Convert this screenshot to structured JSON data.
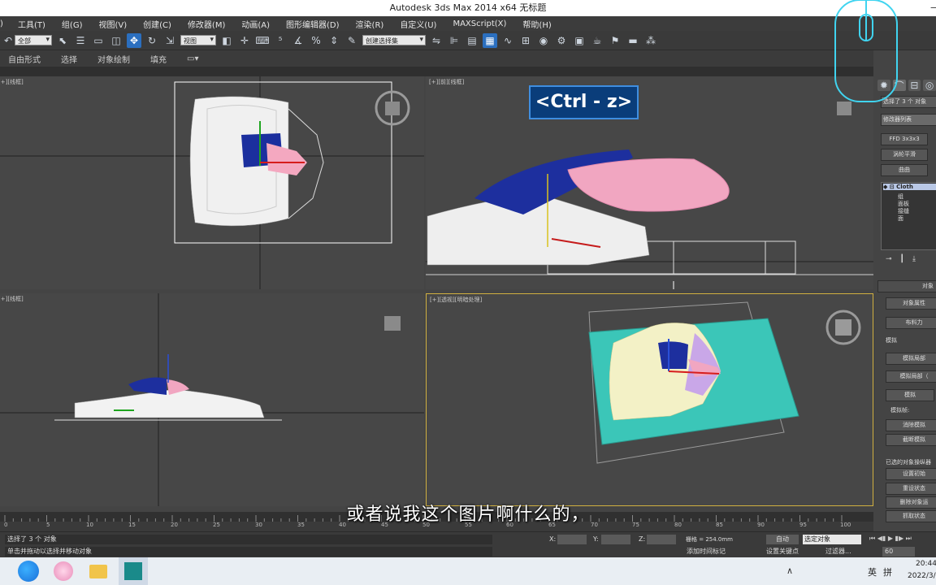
{
  "window": {
    "title": "Autodesk 3ds Max  2014 x64     无标题",
    "minimize": "—"
  },
  "menu": [
    "工具(T)",
    "组(G)",
    "视图(V)",
    "创建(C)",
    "修改器(M)",
    "动画(A)",
    "图形编辑器(D)",
    "渲染(R)",
    "自定义(U)",
    "MAXScript(X)",
    "帮助(H)"
  ],
  "toolbar": {
    "selection_filter": "全部",
    "ref_coord": "视图",
    "named_selection": "创建选择集"
  },
  "ribbon": {
    "tabs": [
      "自由形式",
      "选择",
      "对象绘制",
      "填充"
    ]
  },
  "viewports": {
    "top": "[+][线框]",
    "front": "[+][前][线框]",
    "left": "[+][线框]",
    "perspective": "[+][透视][明暗处理]"
  },
  "overlay": {
    "ctrlz": "<Ctrl - z>",
    "subtitle": "或者说我这个图片啊什么的，"
  },
  "command_panel": {
    "selected_info": "选择了 3 个 对象",
    "modifier_list": "修改器列表",
    "btn_ffd": "FFD 3x3x3",
    "btn_turbo": "涡轮平滑",
    "btn_bend": "曲曲",
    "stack_root": "Cloth",
    "stack_items": [
      "组",
      "面板",
      "接缝",
      "面"
    ],
    "rollout_object": "对象",
    "btn_obj_props": "对象属性",
    "btn_cloth_forces": "布料力",
    "section_sim": "模拟",
    "btn_sim_local": "模拟局部",
    "btn_sim_local_damp": "模拟局部（",
    "btn_sim": "模拟",
    "label_sim_frame": "模拟帧:",
    "btn_erase_sim": "消除模拟",
    "btn_cut_sim": "截断模拟",
    "section_selected": "已选的对象操纵器",
    "btn_set_init": "设置初始",
    "btn_reset_state": "重设状态",
    "btn_remove": "删除对象运",
    "btn_grab": "抓取状态"
  },
  "timeline": {
    "frame_display": "0 / 100",
    "ticks": [
      "0",
      "5",
      "10",
      "15",
      "20",
      "25",
      "30",
      "35",
      "40",
      "45",
      "50",
      "55",
      "60",
      "65",
      "70",
      "75",
      "80",
      "85",
      "90",
      "95",
      "100"
    ]
  },
  "status": {
    "line1": "选择了 3 个 对象",
    "line2": "单击并拖动以选择并移动对象",
    "x_label": "X:",
    "y_label": "Y:",
    "z_label": "Z:",
    "grid": "栅格 = 254.0mm",
    "auto_key": "自动",
    "set_key": "设置关键点",
    "selected_obj": "选定对象",
    "add_time_tag": "添加时间标记",
    "filter": "过滤器...",
    "frame": "60"
  },
  "taskbar": {
    "ime": "英",
    "ime2": "拼",
    "time": "20:44",
    "date": "2022/3/"
  }
}
